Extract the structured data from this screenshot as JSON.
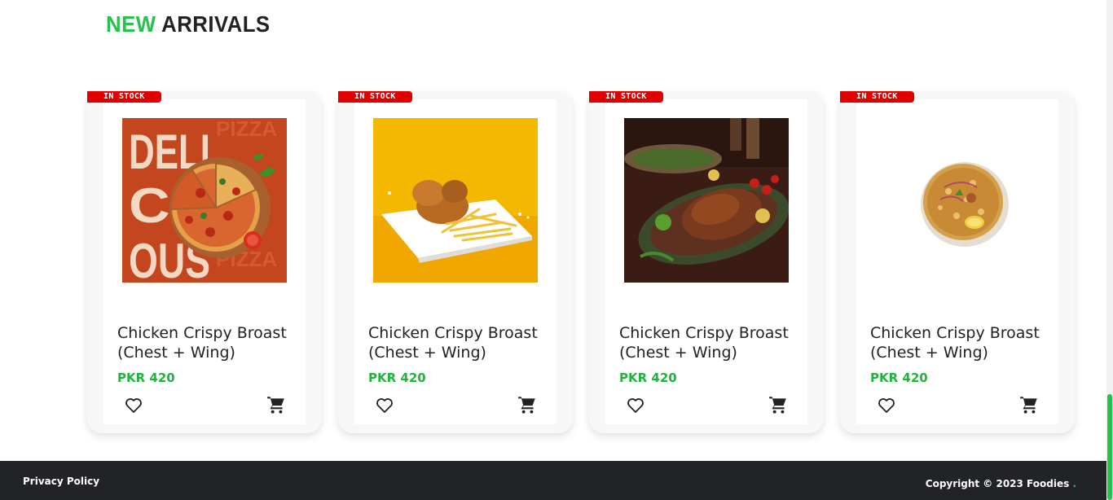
{
  "section": {
    "title_accent": "NEW",
    "title_rest": " ARRIVALS"
  },
  "products": [
    {
      "badge": "IN STOCK",
      "title": "Chicken Crispy Broast (Chest + Wing)",
      "price": "PKR 420",
      "image": "pizza-promo-image",
      "image_text": [
        "DELI",
        "CI",
        "OUS"
      ],
      "image_side_text": "PIZZA"
    },
    {
      "badge": "IN STOCK",
      "title": "Chicken Crispy Broast (Chest + Wing)",
      "price": "PKR 420",
      "image": "fried-chicken-fries-image"
    },
    {
      "badge": "IN STOCK",
      "title": "Chicken Crispy Broast (Chest + Wing)",
      "price": "PKR 420",
      "image": "roast-chicken-platter-image"
    },
    {
      "badge": "IN STOCK",
      "title": "Chicken Crispy Broast (Chest + Wing)",
      "price": "PKR 420",
      "image": "biryani-bowl-image"
    }
  ],
  "footer": {
    "privacy": "Privacy Policy",
    "copyright": "Copyright © 2023 Foodies",
    "copyright_dot": "."
  },
  "colors": {
    "accent": "#27c24c",
    "badge": "#e00000",
    "footer_bg": "#212327",
    "price": "#1fb53c"
  }
}
